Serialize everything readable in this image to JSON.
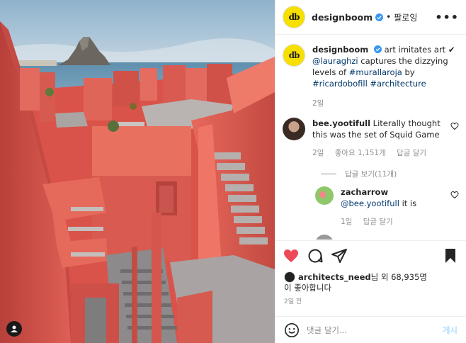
{
  "header": {
    "username": "designboom",
    "follow_label": "팔로잉",
    "avatar_text": "db"
  },
  "caption": {
    "username": "designboom",
    "text_prefix": "art imitates art ✔",
    "mention": "@lauraghzi",
    "text_mid": " captures the dizzying levels of ",
    "hashtag1": "#murallaroja",
    "by": " by ",
    "mention2": "#ricardobofill",
    "hashtag2": "#architecture",
    "time": "2일"
  },
  "comments": [
    {
      "username": "bee.yootifull",
      "text": " Literally thought this was the set of Squid Game",
      "time": "2일",
      "likes": "좋아요 1,151개",
      "reply_label": "답글 달기",
      "view_replies": "답글 보기(11개)"
    }
  ],
  "reply": {
    "username": "zacharrow",
    "mention": "@bee.yootifull",
    "text": " it is",
    "time": "1일",
    "reply_label": "답글 달기"
  },
  "likes_summary": {
    "line1_user": "architects_need",
    "line1_rest": "님 외 68,935명",
    "line2": "이 좋아합니다"
  },
  "post_time": "2일 전",
  "composer": {
    "placeholder": "댓글 달기...",
    "post_label": "게시"
  },
  "colors": {
    "liked_heart": "#ed4956",
    "link": "#00376b",
    "verified": "#3897f0",
    "wall_red": "#d9534a"
  }
}
